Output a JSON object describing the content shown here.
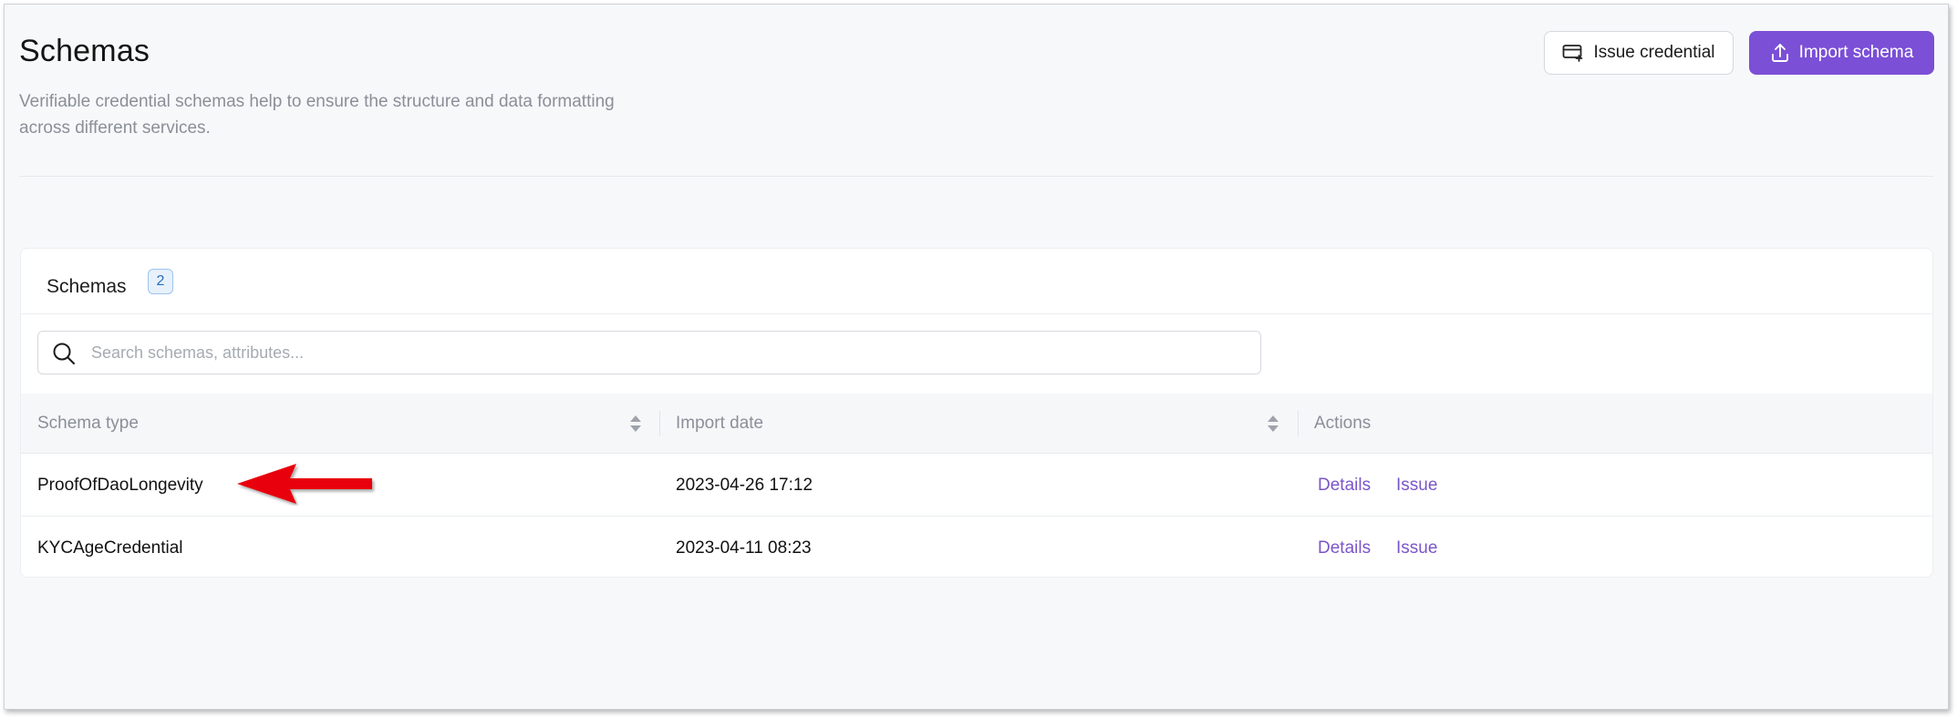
{
  "header": {
    "title": "Schemas",
    "description": "Verifiable credential schemas help to ensure the structure and data formatting across different services.",
    "issue_credential_label": "Issue credential",
    "import_schema_label": "Import schema"
  },
  "card": {
    "title": "Schemas",
    "count": "2"
  },
  "search": {
    "placeholder": "Search schemas, attributes..."
  },
  "table": {
    "columns": [
      "Schema type",
      "Import date",
      "Actions"
    ],
    "rows": [
      {
        "schema_type": "ProofOfDaoLongevity",
        "import_date": "2023-04-26 17:12",
        "details": "Details",
        "issue": "Issue"
      },
      {
        "schema_type": "KYCAgeCredential",
        "import_date": "2023-04-11 08:23",
        "details": "Details",
        "issue": "Issue"
      }
    ]
  },
  "icons": {
    "issue_credential": "card-plus-icon",
    "import_schema": "upload-icon",
    "search": "search-icon",
    "sort": "sort-icon",
    "annotation": "red-arrow-icon"
  },
  "colors": {
    "primary": "#7b4fd6",
    "link": "#7b55c9",
    "badge_bg": "#e7f1fc",
    "badge_border": "#9cc4ec",
    "arrow": "#e8000b"
  }
}
